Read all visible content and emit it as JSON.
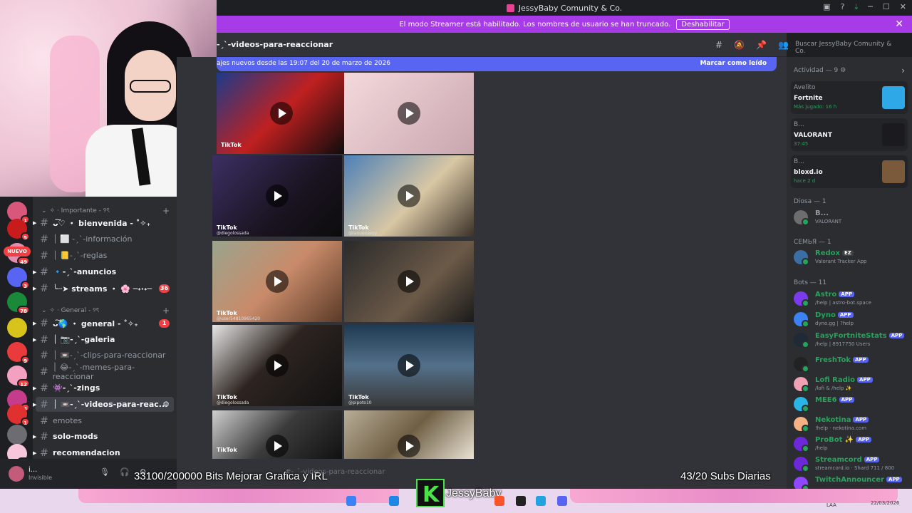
{
  "window": {
    "title": "JessyBaby Comunity & Co.",
    "controls": [
      "─",
      "☐",
      "✕"
    ]
  },
  "banner": {
    "text": "El modo Streamer está habilitado. Los nombres de usuario se han truncado.",
    "button": "Deshabilitar"
  },
  "channel_header": {
    "title": "-ˏˋ-videos-para-reaccionar",
    "search_placeholder": "Buscar JessyBaby Comunity & Co."
  },
  "new_messages": {
    "text": "ajes nuevos desde las 19:07 del 20 de marzo de 2026",
    "action": "Marcar como leído"
  },
  "servers": [
    {
      "badge": "1",
      "color": "#d9577a"
    },
    {
      "badge": "5",
      "color": "#c81c1c"
    },
    {
      "badge": "49",
      "color": "#e58fb0"
    },
    {
      "badge": "3",
      "color": "#5865f2"
    },
    {
      "badge": "78",
      "color": "#1a8a3a"
    },
    {
      "badge": "",
      "color": "#d8c21c"
    },
    {
      "badge": "9",
      "color": "#e93b3b"
    },
    {
      "badge": "12",
      "color": "#f4a0c0"
    },
    {
      "badge": "3",
      "color": "#c43c8b"
    },
    {
      "badge": "1",
      "color": "#e0302f"
    },
    {
      "badge": "",
      "color": "#6c6c72"
    },
    {
      "badge": "40",
      "color": "#f7c6da"
    }
  ],
  "nuevo_label": "NUEVO",
  "categories": {
    "importante": "✧ · Importante - ୨ৎ",
    "general": "✧ · General - ୨ৎ"
  },
  "channels": [
    {
      "name": "ᴗ͠♡ ・ bienvenida - ˚✧₊",
      "unread": true
    },
    {
      "name": "│ ⬜ -ˏˋ-información",
      "unread": false
    },
    {
      "name": "│ 📒-ˏˋ-reglas",
      "unread": false
    },
    {
      "name": "🔹-ˏˋ-anuncios",
      "unread": true
    },
    {
      "name": "╰┈➤ streams ・ 🌸 ─˖·˖─",
      "unread": true,
      "badge": "36"
    },
    {
      "name": "ᴗ͠🌎 ・ general - ˚✧₊",
      "unread": true,
      "badge": "1"
    },
    {
      "name": "│ 📷-ˏˋ-galeria",
      "unread": true
    },
    {
      "name": "│ 📼-ˏˋ-clips-para-reaccionar",
      "unread": false
    },
    {
      "name": "│ 😂-ˏˋ-memes-para-reaccionar",
      "unread": false
    },
    {
      "name": "👾-ˏˋ-zings",
      "unread": true
    },
    {
      "name": "│ 📼-ˏˋ-videos-para-reac...",
      "unread": true,
      "selected": true
    },
    {
      "name": "emotes",
      "unread": false
    },
    {
      "name": "solo-mods",
      "unread": true
    },
    {
      "name": "recomendacion",
      "unread": true
    }
  ],
  "user_panel": {
    "name": "i...",
    "status": "Invisible"
  },
  "videos": [
    {
      "tiktok": "TikTok",
      "handle": "",
      "bg": "linear-gradient(135deg,#1c3b8a,#c02020 50%,#0b0b0b)"
    },
    {
      "tiktok": "",
      "handle": "",
      "bg": "linear-gradient(135deg,#f3d9dc,#c9a6ae)"
    },
    {
      "tiktok": "TikTok",
      "handle": "@diegolossada",
      "bg": "linear-gradient(135deg,#3c2f63,#1a1320 60%,#0c0c0c)"
    },
    {
      "tiktok": "TikTok",
      "handle": "@lanuevasoy",
      "bg": "linear-gradient(135deg,#4d80b8,#d8c7a4 55%,#3b3128)"
    },
    {
      "tiktok": "TikTok",
      "handle": "@user54810965420",
      "bg": "linear-gradient(135deg,#9aa48e,#c98b6a 50%,#5b3a27)"
    },
    {
      "tiktok": "",
      "handle": "",
      "bg": "linear-gradient(135deg,#2a2a2a,#6c5a48 60%,#1a1a1a)"
    },
    {
      "tiktok": "TikTok",
      "handle": "@diegolossada",
      "bg": "linear-gradient(135deg,#e6e6e6,#2d2420 45%,#111)"
    },
    {
      "tiktok": "TikTok",
      "handle": "@pipoto10",
      "bg": "linear-gradient(180deg,#1f3a52,#53708a 50%,#3a3a3a)"
    },
    {
      "tiktok": "TikTok",
      "handle": "",
      "bg": "linear-gradient(135deg,#cfcfcf,#3b3b3b 50%,#111)"
    },
    {
      "tiktok": "",
      "handle": "",
      "bg": "linear-gradient(135deg,#b8ad97,#6f5f44 50%,#e9e2d4)"
    }
  ],
  "overlay": {
    "bits": "33100/200000 Bits Mejorar Grafica y IRL",
    "subs": "43/20 Subs Diarias",
    "streamer": "JessyBaby",
    "ghost_channel": "#-ˏˋ-videos-para-reaccionar"
  },
  "members": {
    "activity_title": "Actividad — 9",
    "activities": [
      {
        "name": "Avelito",
        "game": "Fortnite",
        "meta": "Más jugado: 16 h",
        "color": "#2fa8e8"
      },
      {
        "name": "B...",
        "game": "VALORANT",
        "meta": "37:45",
        "color": "#1b1b1f"
      },
      {
        "name": "B...",
        "game": "bloxd.io",
        "meta": "hace 2 d",
        "color": "#7b5a3c"
      }
    ],
    "diosa_title": "Diosa — 1",
    "diosa": [
      {
        "name": "B...",
        "sub": "VALORANT",
        "color": "#6d6d6d"
      }
    ],
    "semya_title": "СЕМЬЯ — 1",
    "semya": [
      {
        "name": "Redox",
        "sub": "Valorant Tracker App",
        "color": "#3a6ea5",
        "tag": "EZ"
      }
    ],
    "bots_title": "Bots — 11",
    "bots": [
      {
        "name": "Astro",
        "sub": "/help | astro-bot.space",
        "color": "#7c3aed",
        "app": "APP"
      },
      {
        "name": "Dyno",
        "sub": "dyno.gg | ?help",
        "color": "#3b82f6",
        "app": "APP"
      },
      {
        "name": "EasyFortniteStats",
        "sub": "/help | 8917750 Users",
        "color": "#1f2937",
        "app": "APP"
      },
      {
        "name": "FreshTok",
        "sub": "",
        "color": "#222",
        "app": "APP"
      },
      {
        "name": "Lofi Radio",
        "sub": "/lofi & /help ✨",
        "color": "#f0a1b4",
        "app": "APP"
      },
      {
        "name": "MEE6",
        "sub": "",
        "color": "#29b6e6",
        "app": "APP"
      },
      {
        "name": "Nekotina",
        "sub": "!help · nekotina.com",
        "color": "#f4b183",
        "app": "APP"
      },
      {
        "name": "ProBot ✨",
        "sub": "/help",
        "color": "#6d28d9",
        "app": "APP"
      },
      {
        "name": "Streamcord",
        "sub": "streamcord.io · Shard 711 / 800",
        "color": "#6d28d9",
        "app": "APP"
      },
      {
        "name": "TwitchAnnouncer",
        "sub": "",
        "color": "#9146ff",
        "app": "APP"
      }
    ]
  },
  "taskbar": {
    "lang": "LAA",
    "date": "22/03/2026"
  }
}
